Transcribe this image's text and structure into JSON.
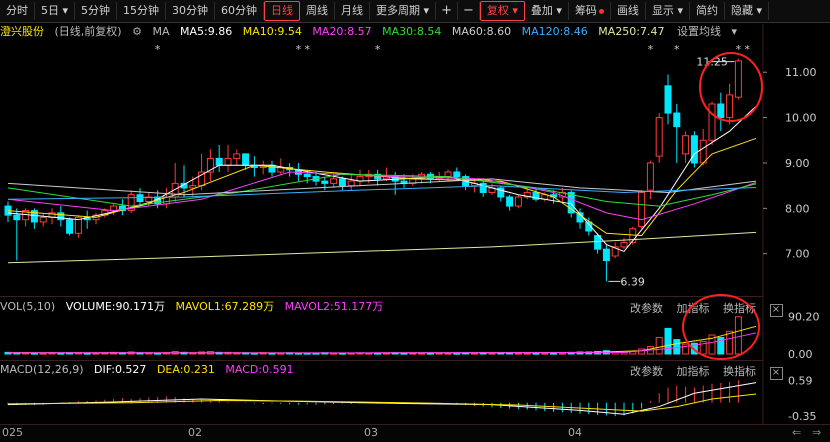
{
  "toolbar": {
    "items": [
      "分时",
      "5日",
      "5分钟",
      "15分钟",
      "30分钟",
      "60分钟",
      "日线",
      "周线",
      "月线",
      "更多周期"
    ],
    "more_arrow": "▾",
    "plus": "+",
    "minus": "−",
    "fuquan": "复权",
    "diejia": "叠加",
    "chouma": "筹码",
    "huaxian": "画线",
    "xianshi": "显示",
    "jianyue": "简约",
    "yincang": "隐藏"
  },
  "kline_legend": {
    "stock": "澄兴股份",
    "period": "(日线,前复权)",
    "ma_label": "MA",
    "ma5": "MA5:9.86",
    "ma10": "MA10:9.54",
    "ma20": "MA20:8.57",
    "ma30": "MA30:8.54",
    "ma60": "MA60:8.60",
    "ma120": "MA120:8.46",
    "ma250": "MA250:7.47",
    "settings": "设置均线",
    "high_label": "11.25",
    "low_label": "6.39"
  },
  "vol_legend": {
    "name": "VOL(5,10)",
    "volume": "VOLUME:90.171万",
    "mavol1": "MAVOL1:67.289万",
    "mavol2": "MAVOL2:51.177万"
  },
  "macd_legend": {
    "name": "MACD(12,26,9)",
    "dif": "DIF:0.527",
    "dea": "DEA:0.231",
    "macd": "MACD:0.591"
  },
  "panel_buttons": {
    "change": "改参数",
    "add": "加指标",
    "swap": "换指标",
    "close": "×"
  },
  "price_axis": [
    "11.00",
    "10.00",
    "9.00",
    "8.00",
    "7.00"
  ],
  "vol_axis": [
    "90.20",
    "0.00"
  ],
  "macd_axis": [
    "0.59",
    "-0.35"
  ],
  "date_axis": [
    "025",
    "02",
    "03",
    "04"
  ],
  "colors": {
    "up": "#ff3a3a",
    "down": "#00e6ff",
    "ma5": "#ffffff",
    "ma10": "#ffe400",
    "ma20": "#ff3dff",
    "ma30": "#33dd33",
    "ma60": "#cccccc",
    "ma120": "#38b0ff",
    "ma250": "#e6e6a0"
  },
  "chart_data": {
    "type": "candlestick",
    "y_range": [
      6.2,
      11.6
    ],
    "candles": [
      [
        8.05,
        7.85,
        8.15,
        7.7
      ],
      [
        7.85,
        7.75,
        8.0,
        6.85
      ],
      [
        7.75,
        7.95,
        8.0,
        7.6
      ],
      [
        7.95,
        7.7,
        8.0,
        7.55
      ],
      [
        7.7,
        7.8,
        7.9,
        7.6
      ],
      [
        7.8,
        7.9,
        8.0,
        7.65
      ],
      [
        7.9,
        7.75,
        8.05,
        7.6
      ],
      [
        7.75,
        7.45,
        7.8,
        7.4
      ],
      [
        7.45,
        7.8,
        7.85,
        7.35
      ],
      [
        7.8,
        7.75,
        7.95,
        7.55
      ],
      [
        7.75,
        7.85,
        7.9,
        7.65
      ],
      [
        7.85,
        7.95,
        8.0,
        7.8
      ],
      [
        7.95,
        8.05,
        8.1,
        7.85
      ],
      [
        8.05,
        7.95,
        8.2,
        7.85
      ],
      [
        7.95,
        8.3,
        8.4,
        7.9
      ],
      [
        8.3,
        8.15,
        8.45,
        8.05
      ],
      [
        8.15,
        8.25,
        8.35,
        8.05
      ],
      [
        8.25,
        8.1,
        8.4,
        8.0
      ],
      [
        8.1,
        8.25,
        8.45,
        8.0
      ],
      [
        8.25,
        8.55,
        9.0,
        8.15
      ],
      [
        8.55,
        8.45,
        8.95,
        8.25
      ],
      [
        8.45,
        8.5,
        8.7,
        8.25
      ],
      [
        8.5,
        8.8,
        9.2,
        8.4
      ],
      [
        8.8,
        9.1,
        9.3,
        8.6
      ],
      [
        9.1,
        8.95,
        9.4,
        8.8
      ],
      [
        8.95,
        9.1,
        9.4,
        8.8
      ],
      [
        9.1,
        9.2,
        9.3,
        8.95
      ],
      [
        9.2,
        8.95,
        9.2,
        8.85
      ],
      [
        8.95,
        8.9,
        9.15,
        8.7
      ],
      [
        8.9,
        8.95,
        9.05,
        8.75
      ],
      [
        8.95,
        8.8,
        9.05,
        8.7
      ],
      [
        8.8,
        8.9,
        9.1,
        8.75
      ],
      [
        8.9,
        8.85,
        9.0,
        8.7
      ],
      [
        8.85,
        8.75,
        9.0,
        8.6
      ],
      [
        8.75,
        8.7,
        8.85,
        8.55
      ],
      [
        8.7,
        8.6,
        8.8,
        8.5
      ],
      [
        8.6,
        8.55,
        8.7,
        8.4
      ],
      [
        8.55,
        8.65,
        8.75,
        8.45
      ],
      [
        8.65,
        8.5,
        8.7,
        8.4
      ],
      [
        8.5,
        8.6,
        8.75,
        8.4
      ],
      [
        8.6,
        8.7,
        8.85,
        8.5
      ],
      [
        8.7,
        8.75,
        8.85,
        8.55
      ],
      [
        8.75,
        8.65,
        8.85,
        8.5
      ],
      [
        8.65,
        8.7,
        8.9,
        8.6
      ],
      [
        8.7,
        8.6,
        8.8,
        8.3
      ],
      [
        8.6,
        8.55,
        8.75,
        8.45
      ],
      [
        8.55,
        8.65,
        8.75,
        8.5
      ],
      [
        8.65,
        8.75,
        8.8,
        8.55
      ],
      [
        8.75,
        8.65,
        8.8,
        8.55
      ],
      [
        8.65,
        8.7,
        8.8,
        8.6
      ],
      [
        8.7,
        8.8,
        8.85,
        8.6
      ],
      [
        8.8,
        8.7,
        8.9,
        8.65
      ],
      [
        8.7,
        8.5,
        8.75,
        8.4
      ],
      [
        8.5,
        8.55,
        8.65,
        8.35
      ],
      [
        8.55,
        8.35,
        8.6,
        8.25
      ],
      [
        8.35,
        8.45,
        8.55,
        8.3
      ],
      [
        8.45,
        8.25,
        8.5,
        8.15
      ],
      [
        8.25,
        8.05,
        8.3,
        7.95
      ],
      [
        8.05,
        8.25,
        8.3,
        8.0
      ],
      [
        8.25,
        8.35,
        8.45,
        8.2
      ],
      [
        8.35,
        8.2,
        8.45,
        8.15
      ],
      [
        8.2,
        8.3,
        8.35,
        8.15
      ],
      [
        8.3,
        8.25,
        8.4,
        8.1
      ],
      [
        8.25,
        8.35,
        8.45,
        8.15
      ],
      [
        8.35,
        7.9,
        8.4,
        7.8
      ],
      [
        7.9,
        7.7,
        8.0,
        7.55
      ],
      [
        7.7,
        7.5,
        7.8,
        7.4
      ],
      [
        7.4,
        7.1,
        7.45,
        7.0
      ],
      [
        7.1,
        6.85,
        7.2,
        6.39
      ],
      [
        6.95,
        7.15,
        7.25,
        6.9
      ],
      [
        7.15,
        7.25,
        7.35,
        7.1
      ],
      [
        7.25,
        7.55,
        7.6,
        7.2
      ],
      [
        7.6,
        8.35,
        8.4,
        7.55
      ],
      [
        8.4,
        9.0,
        9.05,
        8.2
      ],
      [
        9.15,
        10.0,
        10.1,
        9.0
      ],
      [
        10.7,
        10.1,
        10.95,
        9.85
      ],
      [
        10.1,
        9.8,
        10.3,
        9.0
      ],
      [
        9.2,
        9.6,
        9.7,
        9.0
      ],
      [
        9.6,
        9.0,
        9.7,
        8.9
      ],
      [
        9.0,
        9.5,
        9.75,
        8.95
      ],
      [
        9.5,
        10.3,
        10.35,
        9.4
      ],
      [
        10.3,
        10.0,
        10.55,
        9.7
      ],
      [
        10.0,
        10.5,
        10.75,
        9.85
      ],
      [
        10.45,
        11.25,
        11.3,
        10.4
      ]
    ],
    "ma": {
      "ma5": [
        [
          0,
          7.9
        ],
        [
          8,
          7.75
        ],
        [
          16,
          8.1
        ],
        [
          24,
          8.95
        ],
        [
          30,
          8.95
        ],
        [
          40,
          8.6
        ],
        [
          50,
          8.7
        ],
        [
          58,
          8.3
        ],
        [
          64,
          8.1
        ],
        [
          68,
          7.2
        ],
        [
          70,
          7.05
        ],
        [
          74,
          8.0
        ],
        [
          78,
          9.2
        ],
        [
          82,
          9.7
        ],
        [
          85,
          10.25
        ]
      ],
      "ma10": [
        [
          0,
          7.95
        ],
        [
          10,
          7.8
        ],
        [
          20,
          8.35
        ],
        [
          28,
          8.95
        ],
        [
          36,
          8.8
        ],
        [
          46,
          8.65
        ],
        [
          56,
          8.6
        ],
        [
          62,
          8.25
        ],
        [
          68,
          7.45
        ],
        [
          72,
          7.4
        ],
        [
          76,
          8.4
        ],
        [
          80,
          9.2
        ],
        [
          85,
          9.54
        ]
      ],
      "ma20": [
        [
          0,
          8.2
        ],
        [
          12,
          7.95
        ],
        [
          22,
          8.2
        ],
        [
          32,
          8.8
        ],
        [
          44,
          8.7
        ],
        [
          54,
          8.65
        ],
        [
          62,
          8.35
        ],
        [
          68,
          7.9
        ],
        [
          72,
          7.75
        ],
        [
          78,
          8.1
        ],
        [
          85,
          8.57
        ]
      ],
      "ma30": [
        [
          0,
          8.45
        ],
        [
          14,
          8.05
        ],
        [
          26,
          8.35
        ],
        [
          38,
          8.75
        ],
        [
          50,
          8.7
        ],
        [
          60,
          8.45
        ],
        [
          68,
          8.15
        ],
        [
          74,
          8.05
        ],
        [
          80,
          8.3
        ],
        [
          85,
          8.54
        ]
      ],
      "ma60": [
        [
          0,
          8.55
        ],
        [
          20,
          8.3
        ],
        [
          40,
          8.5
        ],
        [
          55,
          8.65
        ],
        [
          65,
          8.45
        ],
        [
          75,
          8.35
        ],
        [
          85,
          8.6
        ]
      ],
      "ma120": [
        [
          0,
          8.2
        ],
        [
          20,
          8.25
        ],
        [
          40,
          8.4
        ],
        [
          55,
          8.5
        ],
        [
          70,
          8.35
        ],
        [
          85,
          8.46
        ]
      ],
      "ma250": [
        [
          0,
          6.8
        ],
        [
          20,
          6.92
        ],
        [
          40,
          7.05
        ],
        [
          55,
          7.15
        ],
        [
          70,
          7.3
        ],
        [
          85,
          7.47
        ]
      ]
    },
    "volume": [
      4,
      3,
      3,
      2,
      2,
      3,
      2,
      3,
      3,
      2,
      2,
      3,
      4,
      3,
      5,
      3,
      3,
      2,
      3,
      6,
      4,
      3,
      5,
      6,
      4,
      4,
      3,
      3,
      2,
      3,
      2,
      2,
      3,
      2,
      2,
      2,
      3,
      2,
      2,
      2,
      3,
      2,
      2,
      2,
      3,
      2,
      2,
      2,
      2,
      2,
      2,
      2,
      3,
      2,
      3,
      2,
      3,
      3,
      2,
      2,
      2,
      2,
      2,
      2,
      4,
      5,
      5,
      6,
      8,
      4,
      4,
      6,
      12,
      18,
      40,
      62,
      35,
      24,
      26,
      30,
      46,
      40,
      55,
      90
    ],
    "vol_ma": [
      [
        0,
        3
      ],
      [
        40,
        2.5
      ],
      [
        66,
        3.5
      ],
      [
        72,
        8
      ],
      [
        76,
        25
      ],
      [
        80,
        38
      ],
      [
        85,
        67
      ]
    ],
    "vol_ma2": [
      [
        0,
        3
      ],
      [
        40,
        2.8
      ],
      [
        70,
        4
      ],
      [
        76,
        15
      ],
      [
        80,
        28
      ],
      [
        85,
        51
      ]
    ],
    "macd_bars": [
      -0.05,
      -0.06,
      -0.05,
      -0.06,
      -0.05,
      -0.03,
      -0.02,
      0.02,
      0.04,
      0.05,
      0.06,
      0.08,
      0.1,
      0.12,
      0.1,
      0.12,
      0.14,
      0.15,
      0.16,
      0.15,
      0.12,
      0.1,
      0.08,
      0.05,
      0.04,
      0.02,
      0.01,
      -0.01,
      -0.02,
      -0.03,
      -0.02,
      -0.03,
      -0.04,
      -0.05,
      -0.04,
      -0.05,
      -0.04,
      -0.03,
      -0.02,
      -0.03,
      -0.02,
      -0.01,
      0.01,
      0.02,
      0.01,
      0.02,
      0.01,
      -0.01,
      -0.02,
      -0.03,
      -0.04,
      -0.05,
      -0.06,
      -0.08,
      -0.1,
      -0.12,
      -0.14,
      -0.15,
      -0.17,
      -0.18,
      -0.2,
      -0.22,
      -0.24,
      -0.25,
      -0.27,
      -0.29,
      -0.3,
      -0.32,
      -0.33,
      -0.35,
      -0.33,
      -0.28,
      -0.15,
      0.05,
      0.25,
      0.4,
      0.45,
      0.42,
      0.4,
      0.45,
      0.5,
      0.52,
      0.55,
      0.59
    ],
    "dif": [
      [
        0,
        -0.05
      ],
      [
        12,
        0.02
      ],
      [
        22,
        0.1
      ],
      [
        30,
        0.05
      ],
      [
        45,
        -0.02
      ],
      [
        55,
        -0.05
      ],
      [
        65,
        -0.2
      ],
      [
        70,
        -0.3
      ],
      [
        74,
        -0.1
      ],
      [
        78,
        0.25
      ],
      [
        85,
        0.53
      ]
    ],
    "dea": [
      [
        0,
        -0.03
      ],
      [
        14,
        0.0
      ],
      [
        24,
        0.06
      ],
      [
        34,
        0.04
      ],
      [
        48,
        -0.01
      ],
      [
        58,
        -0.06
      ],
      [
        66,
        -0.15
      ],
      [
        72,
        -0.22
      ],
      [
        76,
        -0.1
      ],
      [
        80,
        0.1
      ],
      [
        85,
        0.23
      ]
    ]
  }
}
